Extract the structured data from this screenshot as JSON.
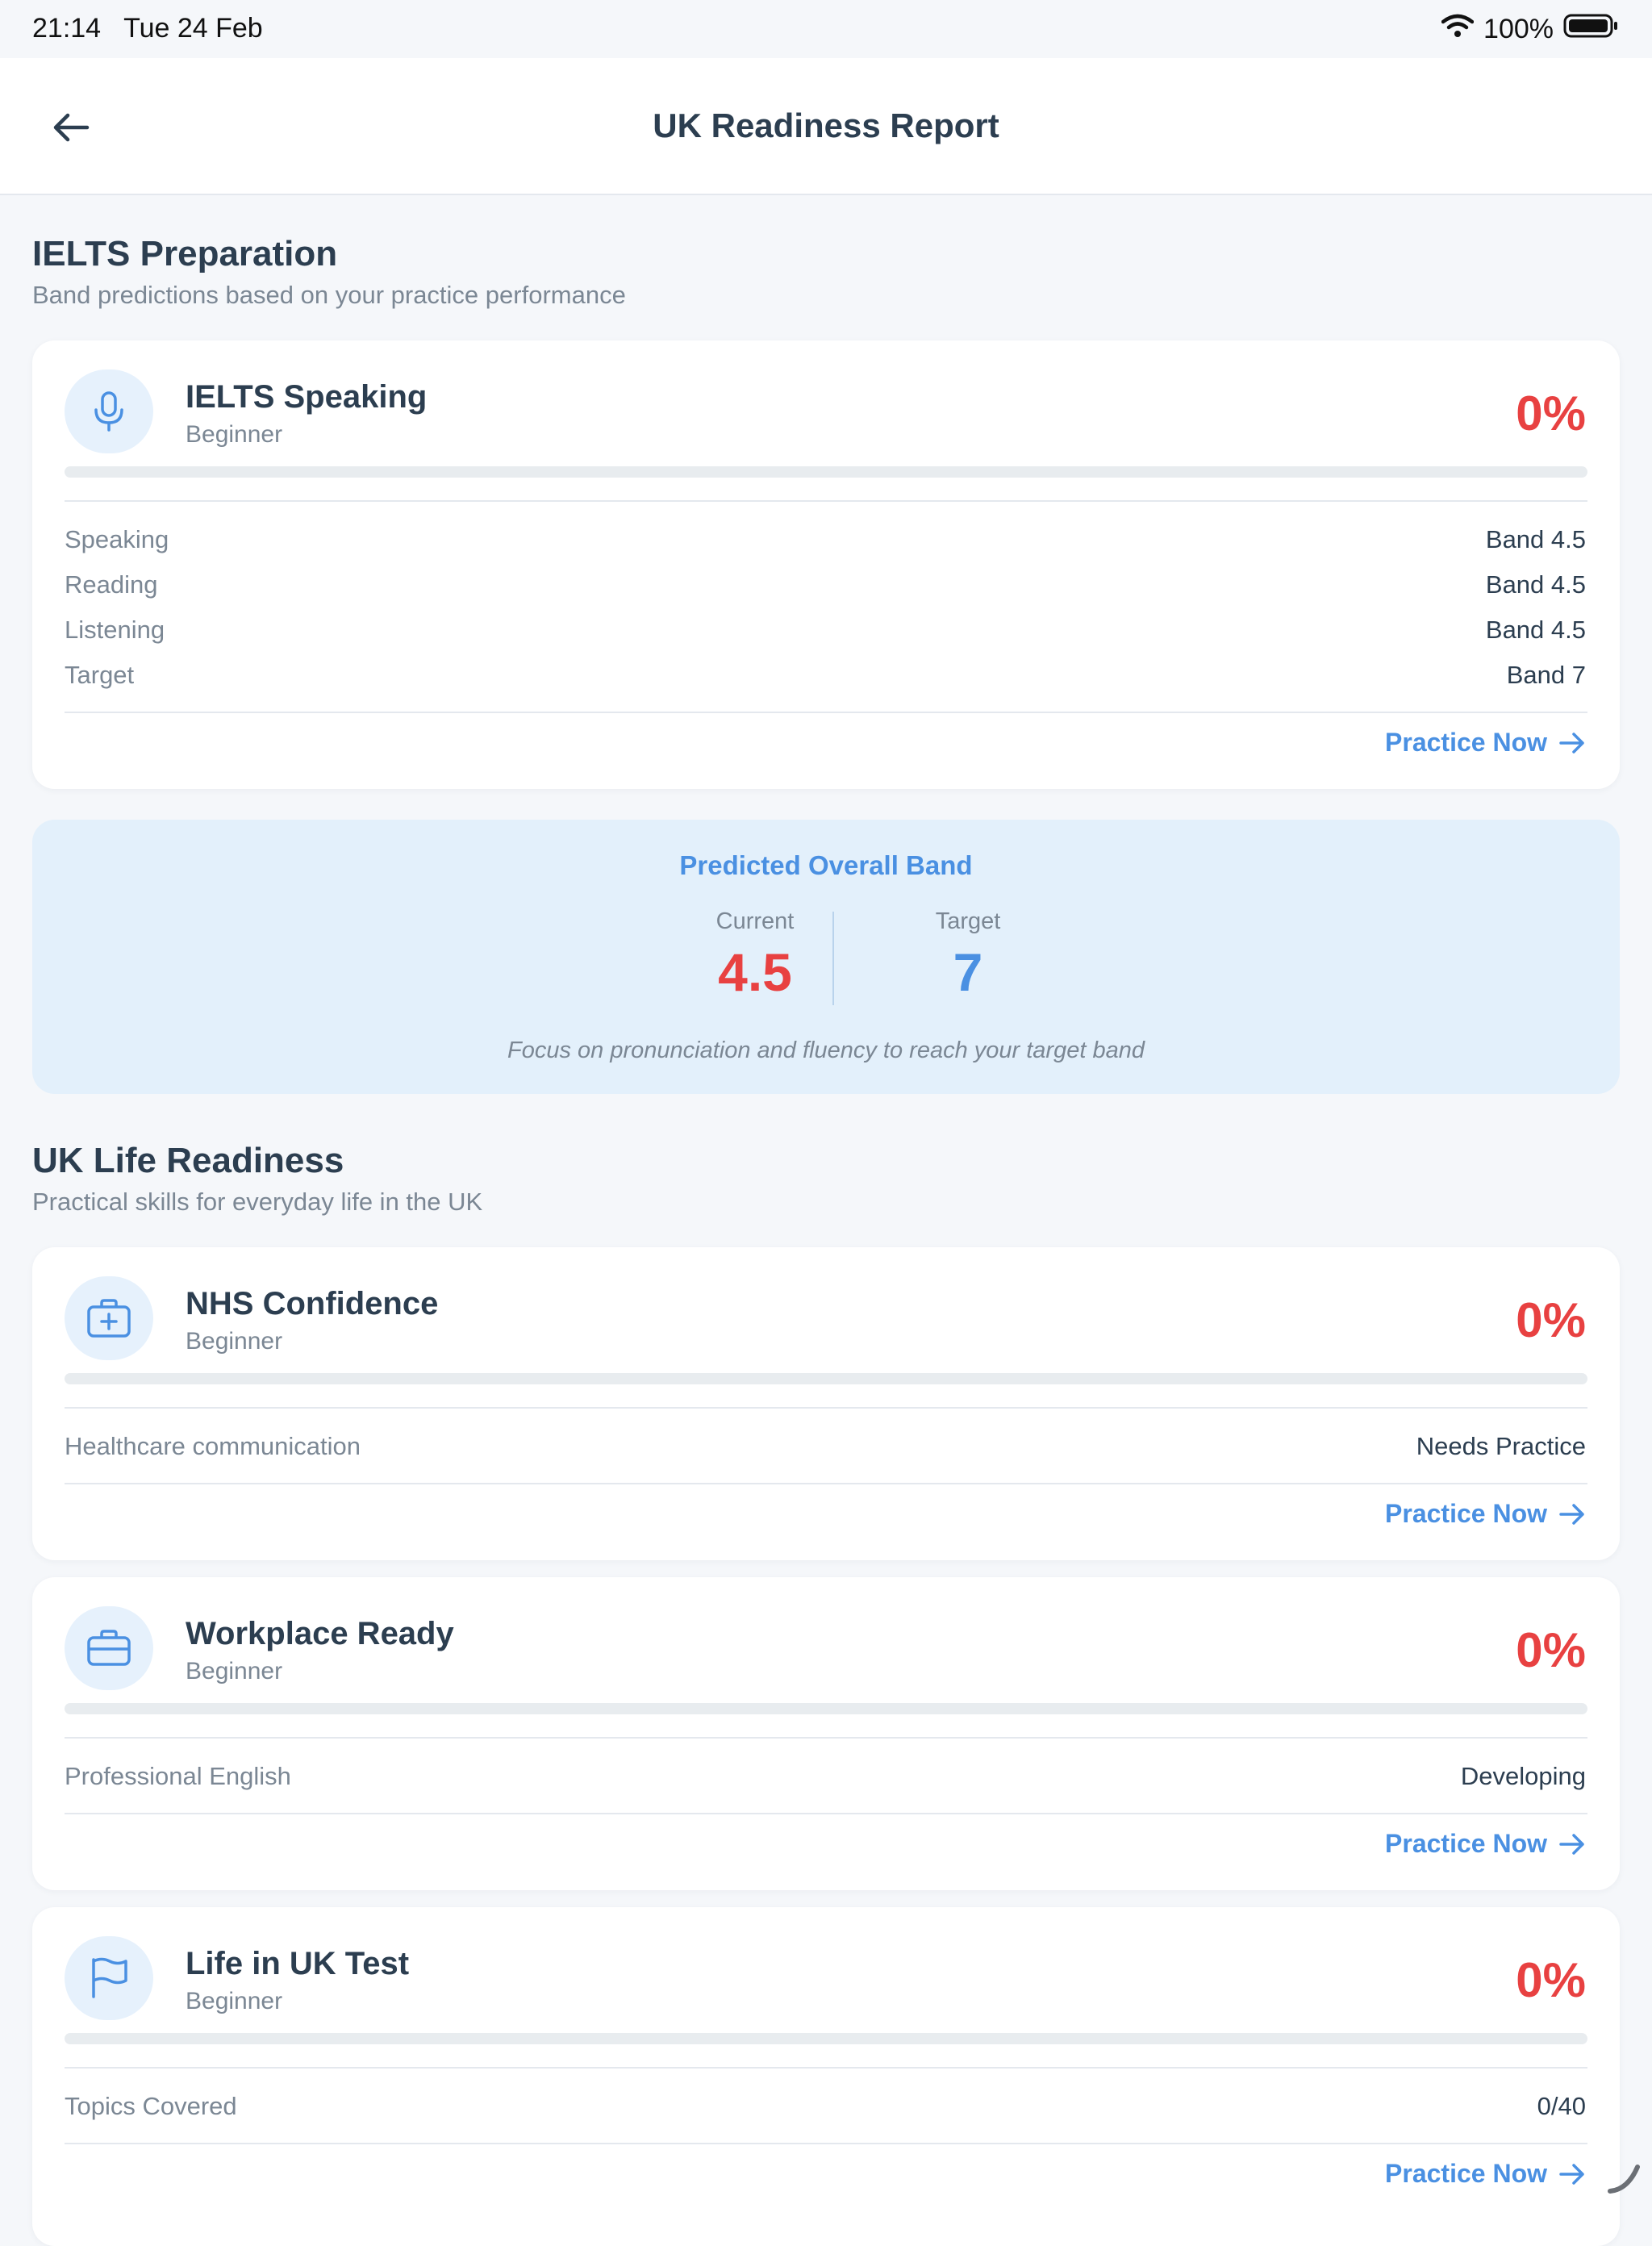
{
  "status_bar": {
    "time": "21:14",
    "date": "Tue 24 Feb",
    "battery": "100%"
  },
  "header": {
    "title": "UK Readiness Report"
  },
  "ielts": {
    "title": "IELTS Preparation",
    "subtitle": "Band predictions based on your practice performance",
    "card": {
      "name": "IELTS Speaking",
      "level": "Beginner",
      "percent": "0%",
      "progress": 0,
      "rows": [
        {
          "label": "Speaking",
          "value": "Band 4.5"
        },
        {
          "label": "Reading",
          "value": "Band 4.5"
        },
        {
          "label": "Listening",
          "value": "Band 4.5"
        },
        {
          "label": "Target",
          "value": "Band 7"
        }
      ],
      "action": "Practice Now"
    },
    "predicted": {
      "title": "Predicted Overall Band",
      "current_label": "Current",
      "current_value": "4.5",
      "target_label": "Target",
      "target_value": "7",
      "tip": "Focus on pronunciation and fluency to reach your target band"
    }
  },
  "life": {
    "title": "UK Life Readiness",
    "subtitle": "Practical skills for everyday life in the UK",
    "cards": [
      {
        "name": "NHS Confidence",
        "level": "Beginner",
        "percent": "0%",
        "progress": 0,
        "row_label": "Healthcare communication",
        "row_value": "Needs Practice",
        "action": "Practice Now"
      },
      {
        "name": "Workplace Ready",
        "level": "Beginner",
        "percent": "0%",
        "progress": 0,
        "row_label": "Professional English",
        "row_value": "Developing",
        "action": "Practice Now"
      },
      {
        "name": "Life in UK Test",
        "level": "Beginner",
        "percent": "0%",
        "progress": 0,
        "row_label": "Topics Covered",
        "row_value": "0/40",
        "action": "Practice Now"
      }
    ]
  },
  "icons": {
    "back": "arrow-left-icon",
    "ielts": "microphone-icon",
    "nhs": "medical-kit-icon",
    "work": "briefcase-icon",
    "uk": "flag-icon",
    "action": "arrow-right-icon"
  },
  "colors": {
    "accent": "#4a90e2",
    "danger": "#e84141",
    "text": "#2c3e50",
    "muted": "#7b8794",
    "band_bg": "#e3f0fb"
  }
}
